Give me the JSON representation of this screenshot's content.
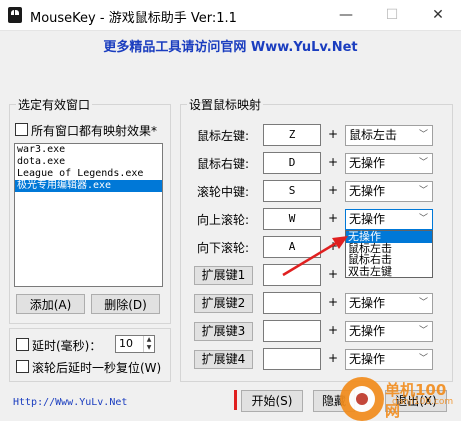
{
  "window": {
    "title": "MouseKey - 游戏鼠标助手 Ver:1.1",
    "controls": {
      "minimize": "—",
      "maximize": "☐",
      "close": "✕"
    }
  },
  "banner": {
    "text": "更多精品工具请访问官网 Www.YuLv.Net"
  },
  "left_panel": {
    "group_title": "选定有效窗口",
    "all_windows_label": "所有窗口都有映射效果*",
    "windows": [
      "war3.exe",
      "dota.exe",
      "League of Legends.exe",
      "极光专用编辑器.exe"
    ],
    "selected_index": 3,
    "add_button": "添加(A)",
    "delete_button": "删除(D)",
    "delay_label": "延时(毫秒)：",
    "delay_value": "10",
    "reset_label": "滚轮后延时一秒复位(W)"
  },
  "right_panel": {
    "group_title": "设置鼠标映射",
    "rows": [
      {
        "label": "鼠标左键:",
        "key": "Z",
        "action": "鼠标左击"
      },
      {
        "label": "鼠标右键:",
        "key": "D",
        "action": "无操作"
      },
      {
        "label": "滚轮中键:",
        "key": "S",
        "action": "无操作"
      },
      {
        "label": "向上滚轮:",
        "key": "W",
        "action": "无操作"
      },
      {
        "label": "向下滚轮:",
        "key": "A",
        "action": ""
      },
      {
        "label": "扩展键1",
        "key": "",
        "action": ""
      },
      {
        "label": "扩展键2",
        "key": "",
        "action": "无操作"
      },
      {
        "label": "扩展键3",
        "key": "",
        "action": "无操作"
      },
      {
        "label": "扩展键4",
        "key": "",
        "action": "无操作"
      }
    ],
    "plus": "+",
    "dropdown_options": [
      "无操作",
      "鼠标左击",
      "鼠标右击",
      "双击左键"
    ],
    "dropdown_highlight": 0
  },
  "footer": {
    "link": "Http://Www.YuLv.Net",
    "start_button": "开始(S)",
    "hide_button": "隐藏",
    "exit_button": "退出(X)"
  },
  "watermark": {
    "text": "单机100网",
    "subtext": "danji100.com"
  },
  "colors": {
    "accent": "#0078d7",
    "banner_text": "#1a3dbf",
    "arrow": "#e02020",
    "watermark": "#f28c1c"
  }
}
